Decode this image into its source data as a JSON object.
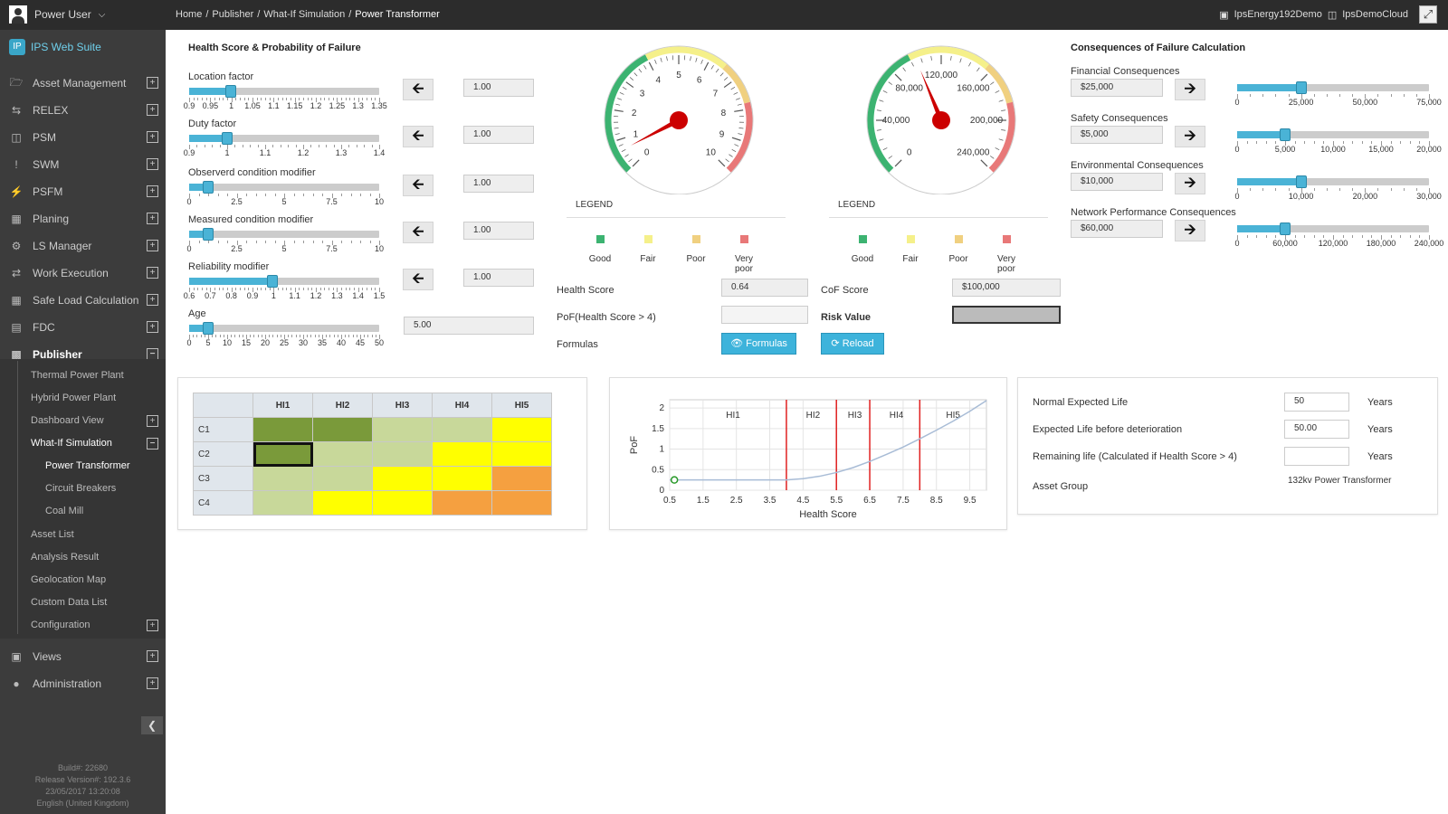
{
  "topbar": {
    "user": "Power User",
    "breadcrumbs": [
      "Home",
      "Publisher",
      "What-If Simulation",
      "Power Transformer"
    ],
    "right_items": [
      "IpsEnergy192Demo",
      "IpsDemoCloud"
    ]
  },
  "sidebar": {
    "brand": "IPS Web Suite",
    "items": [
      {
        "label": "Asset Management",
        "icon": "folder-open-icon"
      },
      {
        "label": "RELEX",
        "icon": "shuffle-icon"
      },
      {
        "label": "PSM",
        "icon": "database-icon"
      },
      {
        "label": "SWM",
        "icon": "exclamation-icon"
      },
      {
        "label": "PSFM",
        "icon": "bolt-icon"
      },
      {
        "label": "Planing",
        "icon": "calendar-icon"
      },
      {
        "label": "LS Manager",
        "icon": "cogs-icon"
      },
      {
        "label": "Work Execution",
        "icon": "retweet-icon"
      },
      {
        "label": "Safe Load Calculation",
        "icon": "calculator-icon"
      },
      {
        "label": "FDC",
        "icon": "archive-icon"
      },
      {
        "label": "Publisher",
        "icon": "bar-chart-icon"
      }
    ],
    "publisher_children": [
      "Thermal Power Plant",
      "Hybrid Power Plant",
      "Dashboard View",
      "What-If Simulation",
      "Power Transformer",
      "Circuit Breakers",
      "Coal Mill",
      "Asset List",
      "Analysis Result",
      "Geolocation Map",
      "Custom Data List",
      "Configuration"
    ],
    "bottom_items": [
      {
        "label": "Views",
        "icon": "image-icon"
      },
      {
        "label": "Administration",
        "icon": "user-icon"
      }
    ],
    "build": [
      "Build#: 22680",
      "Release Version#: 192.3.6",
      "23/05/2017 13:20:08",
      "English (United Kingdom)"
    ]
  },
  "health": {
    "title": "Health Score & Probability of Failure",
    "sliders": [
      {
        "label": "Location factor",
        "value": "1.00",
        "ticks": [
          "0.9",
          "0.95",
          "1",
          "1.05",
          "1.1",
          "1.15",
          "1.2",
          "1.25",
          "1.3",
          "1.35"
        ],
        "pos": 0.22
      },
      {
        "label": "Duty factor",
        "value": "1.00",
        "ticks": [
          "0.9",
          "1",
          "1.1",
          "1.2",
          "1.3",
          "1.4"
        ],
        "pos": 0.2
      },
      {
        "label": "Observerd condition modifier",
        "value": "1.00",
        "ticks": [
          "0",
          "2.5",
          "5",
          "7.5",
          "10"
        ],
        "pos": 0.1
      },
      {
        "label": "Measured condition modifier",
        "value": "1.00",
        "ticks": [
          "0",
          "2.5",
          "5",
          "7.5",
          "10"
        ],
        "pos": 0.1
      },
      {
        "label": "Reliability modifier",
        "value": "1.00",
        "ticks": [
          "0.6",
          "0.7",
          "0.8",
          "0.9",
          "1",
          "1.1",
          "1.2",
          "1.3",
          "1.4",
          "1.5"
        ],
        "pos": 0.44
      },
      {
        "label": "Age",
        "value": "5.00",
        "ticks": [
          "0",
          "5",
          "10",
          "15",
          "20",
          "25",
          "30",
          "35",
          "40",
          "45",
          "50"
        ],
        "pos": 0.1
      }
    ]
  },
  "gauges": {
    "health": {
      "ticks": [
        "0",
        "1",
        "2",
        "3",
        "4",
        "5",
        "6",
        "7",
        "8",
        "9",
        "10"
      ],
      "value": 0.64
    },
    "cof": {
      "ticks": [
        "0",
        "40,000",
        "80,000",
        "120,000",
        "160,000",
        "200,000",
        "240,000"
      ],
      "value": 100000
    }
  },
  "legend": {
    "title": "LEGEND",
    "items": [
      {
        "label": "Good",
        "color": "#3cb371"
      },
      {
        "label": "Fair",
        "color": "#f5f08a"
      },
      {
        "label": "Poor",
        "color": "#f0d080"
      },
      {
        "label": "Very poor",
        "color": "#e87878"
      }
    ]
  },
  "scores": {
    "health_score_label": "Health Score",
    "health_score": "0.64",
    "pof_label": "PoF(Health Score > 4)",
    "pof_value": "",
    "formulas_label": "Formulas",
    "formulas_btn": "Formulas",
    "cof_label": "CoF Score",
    "cof_value": "$100,000",
    "risk_label": "Risk Value",
    "risk_value": "",
    "reload_btn": "Reload"
  },
  "consequences": {
    "title": "Consequences of Failure Calculation",
    "items": [
      {
        "label": "Financial Consequences",
        "value": "$25,000",
        "ticks": [
          "0",
          "25,000",
          "50,000",
          "75,000"
        ],
        "pos": 0.333
      },
      {
        "label": "Safety Consequences",
        "value": "$5,000",
        "ticks": [
          "0",
          "5,000",
          "10,000",
          "15,000",
          "20,000"
        ],
        "pos": 0.25
      },
      {
        "label": "Environmental Consequences",
        "value": "$10,000",
        "ticks": [
          "0",
          "10,000",
          "20,000",
          "30,000"
        ],
        "pos": 0.333
      },
      {
        "label": "Network Performance Consequences",
        "value": "$60,000",
        "ticks": [
          "0",
          "60,000",
          "120,000",
          "180,000",
          "240,000"
        ],
        "pos": 0.25
      }
    ]
  },
  "heatmap": {
    "cols": [
      "HI1",
      "HI2",
      "HI3",
      "HI4",
      "HI5"
    ],
    "rows": [
      "C1",
      "C2",
      "C3",
      "C4"
    ],
    "colors": [
      [
        "#7a9a3a",
        "#7a9a3a",
        "#c8d89a",
        "#c8d89a",
        "#ffff00"
      ],
      [
        "#7a9a3a",
        "#c8d89a",
        "#c8d89a",
        "#ffff00",
        "#ffff00"
      ],
      [
        "#c8d89a",
        "#c8d89a",
        "#ffff00",
        "#ffff00",
        "#f5a040"
      ],
      [
        "#c8d89a",
        "#ffff00",
        "#ffff00",
        "#f5a040",
        "#f5a040"
      ]
    ],
    "selected": [
      1,
      0
    ]
  },
  "chart_data": {
    "type": "line",
    "xlabel": "Health Score",
    "ylabel": "PoF",
    "xlim": [
      0.5,
      10
    ],
    "ylim": [
      0,
      2.2
    ],
    "xticks": [
      "0.5",
      "1.5",
      "2.5",
      "3.5",
      "4.5",
      "5.5",
      "6.5",
      "7.5",
      "8.5",
      "9.5"
    ],
    "yticks": [
      "0",
      "0.5",
      "1",
      "1.5",
      "2"
    ],
    "x": [
      0.5,
      1.5,
      2.5,
      3.5,
      4,
      4.5,
      5,
      5.5,
      6,
      6.5,
      7,
      7.5,
      8,
      8.5,
      9,
      9.5,
      10
    ],
    "y": [
      0.25,
      0.25,
      0.25,
      0.25,
      0.25,
      0.28,
      0.34,
      0.43,
      0.55,
      0.7,
      0.87,
      1.05,
      1.25,
      1.46,
      1.68,
      1.92,
      2.18
    ],
    "current_point": {
      "x": 0.64,
      "y": 0.25
    },
    "thresholds": [
      {
        "label": "HI1",
        "x": 4
      },
      {
        "label": "HI2",
        "x": 5.5
      },
      {
        "label": "HI3",
        "x": 6.5
      },
      {
        "label": "HI4",
        "x": 8
      },
      {
        "label": "HI5",
        "x": 10
      }
    ],
    "band_labels": [
      {
        "label": "HI1",
        "x": 2.4
      },
      {
        "label": "HI2",
        "x": 4.8
      },
      {
        "label": "HI3",
        "x": 6.05
      },
      {
        "label": "HI4",
        "x": 7.3
      },
      {
        "label": "HI5",
        "x": 9.0
      }
    ],
    "threshold_color": "#e02020",
    "line_color": "#a8bcd6"
  },
  "life": {
    "rows": [
      {
        "label": "Normal Expected Life",
        "value": "50",
        "unit": "Years"
      },
      {
        "label": "Expected Life before deterioration",
        "value": "50.00",
        "unit": "Years"
      },
      {
        "label": "Remaining life (Calculated if Health Score > 4)",
        "value": "",
        "unit": "Years"
      }
    ],
    "asset_group_label": "Asset Group",
    "asset_group_value": "132kv Power Transformer"
  }
}
